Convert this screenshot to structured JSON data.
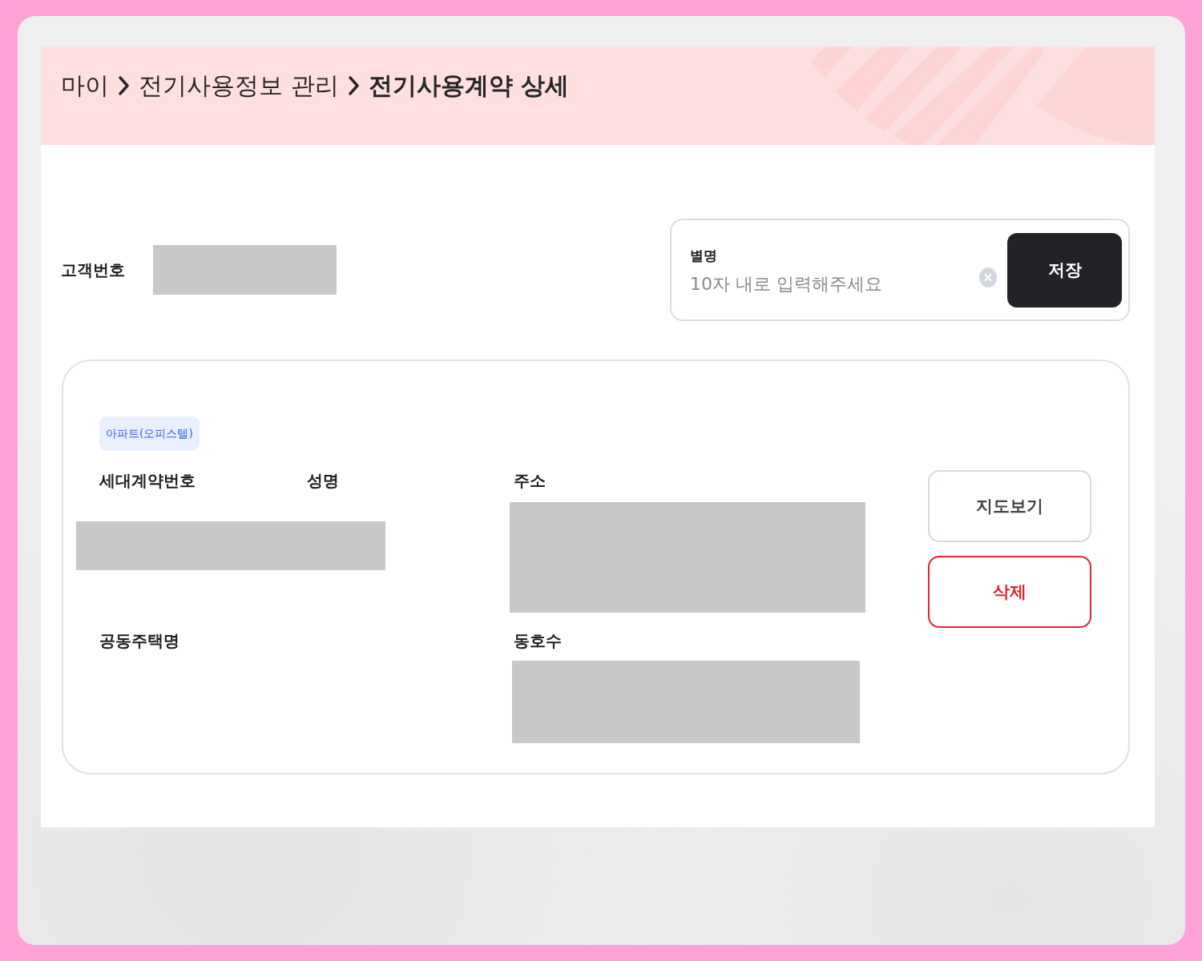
{
  "breadcrumb": [
    {
      "label": "마이",
      "current": false
    },
    {
      "label": "전기사용정보 관리",
      "current": false
    },
    {
      "label": "전기사용계약 상세",
      "current": true
    }
  ],
  "customer": {
    "label": "고객번호",
    "redacted": true
  },
  "alias": {
    "label": "별명",
    "placeholder": "10자 내로 입력해주세요",
    "save_button": "저장"
  },
  "contract": {
    "tag": "아파트(오피스텔)",
    "fields": [
      {
        "label": "세대계약번호",
        "redacted": true
      },
      {
        "label": "성명",
        "redacted": true
      },
      {
        "label": "주소",
        "redacted": true
      },
      {
        "label": "공동주택명",
        "redacted": false
      },
      {
        "label": "동호수",
        "redacted": true
      }
    ],
    "buttons": [
      {
        "label": "지도보기",
        "kind": "default"
      },
      {
        "label": "삭제",
        "kind": "danger"
      }
    ]
  }
}
